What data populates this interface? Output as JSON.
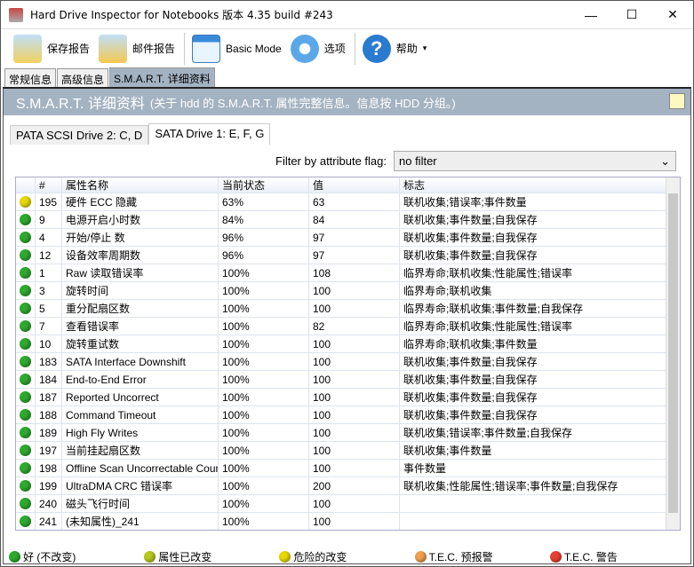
{
  "window": {
    "title": "Hard Drive Inspector for Notebooks 版本 4.35 build #243",
    "min": "—",
    "max": "☐",
    "close": "✕"
  },
  "toolbar": {
    "save": "保存报告",
    "mail": "邮件报告",
    "basic": "Basic Mode",
    "options": "选项",
    "help": "帮助",
    "help_arrow": "▾"
  },
  "tabs": [
    "常规信息",
    "高级信息",
    "S.M.A.R.T. 详细资料"
  ],
  "header": {
    "title": "S.M.A.R.T. 详细资料",
    "subtitle": "(关于 hdd 的 S.M.A.R.T. 属性完整信息。信息按 HDD 分组。)"
  },
  "drive_tabs": [
    "PATA SCSI Drive 2: C, D",
    "SATA Drive 1: E, F, G"
  ],
  "filter": {
    "label": "Filter by attribute flag:",
    "value": "no filter",
    "arrow": "⌄"
  },
  "columns": [
    "#",
    "属性名称",
    "当前状态",
    "值",
    "标志"
  ],
  "colors": {
    "green": "#2eaa2e",
    "yellowgreen": "#b8c820",
    "yellow": "#e8d800",
    "orange": "#f0a050",
    "red": "#e84030"
  },
  "rows": [
    {
      "s": "yellow",
      "id": "195",
      "name": "硬件 ECC 隐藏",
      "status": "63%",
      "value": "63",
      "flags": "联机收集;错误率;事件数量"
    },
    {
      "s": "green",
      "id": "9",
      "name": "电源开启小时数",
      "status": "84%",
      "value": "84",
      "flags": "联机收集;事件数量;自我保存"
    },
    {
      "s": "green",
      "id": "4",
      "name": "开始/停止 数",
      "status": "96%",
      "value": "97",
      "flags": "联机收集;事件数量;自我保存"
    },
    {
      "s": "green",
      "id": "12",
      "name": "设备效率周期数",
      "status": "96%",
      "value": "97",
      "flags": "联机收集;事件数量;自我保存"
    },
    {
      "s": "green",
      "id": "1",
      "name": "Raw 读取错误率",
      "status": "100%",
      "value": "108",
      "flags": "临界寿命;联机收集;性能属性;错误率"
    },
    {
      "s": "green",
      "id": "3",
      "name": "旋转时间",
      "status": "100%",
      "value": "100",
      "flags": "临界寿命;联机收集"
    },
    {
      "s": "green",
      "id": "5",
      "name": "重分配扇区数",
      "status": "100%",
      "value": "100",
      "flags": "临界寿命;联机收集;事件数量;自我保存"
    },
    {
      "s": "green",
      "id": "7",
      "name": "查看错误率",
      "status": "100%",
      "value": "82",
      "flags": "临界寿命;联机收集;性能属性;错误率"
    },
    {
      "s": "green",
      "id": "10",
      "name": "旋转重试数",
      "status": "100%",
      "value": "100",
      "flags": "临界寿命;联机收集;事件数量"
    },
    {
      "s": "green",
      "id": "183",
      "name": "SATA Interface Downshift",
      "status": "100%",
      "value": "100",
      "flags": "联机收集;事件数量;自我保存"
    },
    {
      "s": "green",
      "id": "184",
      "name": "End-to-End Error",
      "status": "100%",
      "value": "100",
      "flags": "联机收集;事件数量;自我保存"
    },
    {
      "s": "green",
      "id": "187",
      "name": "Reported Uncorrect",
      "status": "100%",
      "value": "100",
      "flags": "联机收集;事件数量;自我保存"
    },
    {
      "s": "green",
      "id": "188",
      "name": "Command Timeout",
      "status": "100%",
      "value": "100",
      "flags": "联机收集;事件数量;自我保存"
    },
    {
      "s": "green",
      "id": "189",
      "name": "High Fly Writes",
      "status": "100%",
      "value": "100",
      "flags": "联机收集;错误率;事件数量;自我保存"
    },
    {
      "s": "green",
      "id": "197",
      "name": "当前挂起扇区数",
      "status": "100%",
      "value": "100",
      "flags": "联机收集;事件数量"
    },
    {
      "s": "green",
      "id": "198",
      "name": "Offline Scan Uncorrectable Count",
      "status": "100%",
      "value": "100",
      "flags": "事件数量"
    },
    {
      "s": "green",
      "id": "199",
      "name": "UltraDMA CRC 错误率",
      "status": "100%",
      "value": "200",
      "flags": "联机收集;性能属性;错误率;事件数量;自我保存"
    },
    {
      "s": "green",
      "id": "240",
      "name": "磁头飞行时间",
      "status": "100%",
      "value": "100",
      "flags": ""
    },
    {
      "s": "green",
      "id": "241",
      "name": "(未知属性)_241",
      "status": "100%",
      "value": "100",
      "flags": ""
    }
  ],
  "legend": [
    {
      "color": "green",
      "label": "好 (不改变)"
    },
    {
      "color": "yellowgreen",
      "label": "属性已改变"
    },
    {
      "color": "yellow",
      "label": "危险的改变"
    },
    {
      "color": "orange",
      "label": "T.E.C. 预报警"
    },
    {
      "color": "red",
      "label": "T.E.C. 警告"
    }
  ]
}
